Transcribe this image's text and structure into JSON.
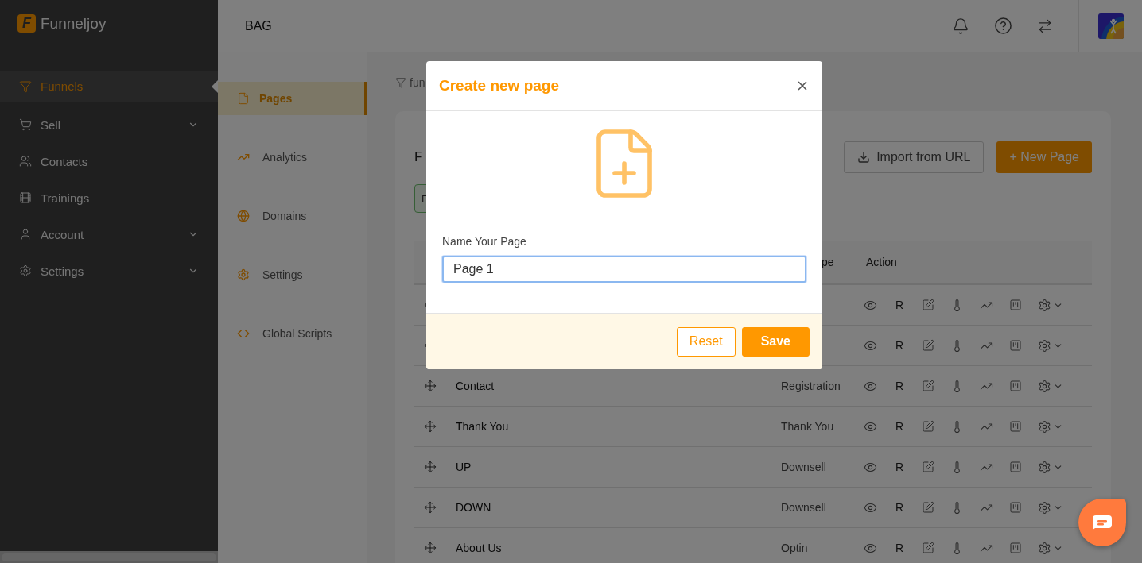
{
  "sidebar": {
    "logo_letter": "F",
    "brand": "Funneljoy",
    "items": [
      {
        "label": "Funnels",
        "selected": true,
        "expandable": false
      },
      {
        "label": "Sell",
        "selected": false,
        "expandable": true
      },
      {
        "label": "Contacts",
        "selected": false,
        "expandable": false
      },
      {
        "label": "Trainings",
        "selected": false,
        "expandable": false
      },
      {
        "label": "Account",
        "selected": false,
        "expandable": true
      },
      {
        "label": "Settings",
        "selected": false,
        "expandable": true
      }
    ]
  },
  "topbar": {
    "title": "BAG"
  },
  "subnav": {
    "items": [
      {
        "label": "Pages",
        "selected": true
      },
      {
        "label": "Analytics",
        "selected": false
      },
      {
        "label": "Domains",
        "selected": false
      },
      {
        "label": "Settings",
        "selected": false
      },
      {
        "label": "Global Scripts",
        "selected": false
      }
    ]
  },
  "content": {
    "breadcrumb": "fun",
    "title": "F",
    "filter_chip": "F",
    "import_button": "Import from URL",
    "new_button": "+ New Page",
    "columns": [
      {
        "label": "pe"
      },
      {
        "label": "Action"
      }
    ],
    "rows": [
      {
        "action_label": "R"
      },
      {
        "action_label": "R"
      },
      {
        "name": "Contact",
        "type": "Registration",
        "action_label": "R"
      },
      {
        "name": "Thank You",
        "type": "Thank You",
        "action_label": "R"
      },
      {
        "name": "UP",
        "type": "Downsell",
        "action_label": "R"
      },
      {
        "name": "DOWN",
        "type": "Downsell",
        "action_label": "R"
      },
      {
        "name": "About Us",
        "type": "Optin",
        "action_label": "R"
      }
    ]
  },
  "modal": {
    "title": "Create new page",
    "field_label": "Name Your Page",
    "field_value": "Page 1",
    "buttons": [
      {
        "label": "Reset",
        "kind": "outline"
      },
      {
        "label": "Save",
        "kind": "primary"
      }
    ]
  }
}
